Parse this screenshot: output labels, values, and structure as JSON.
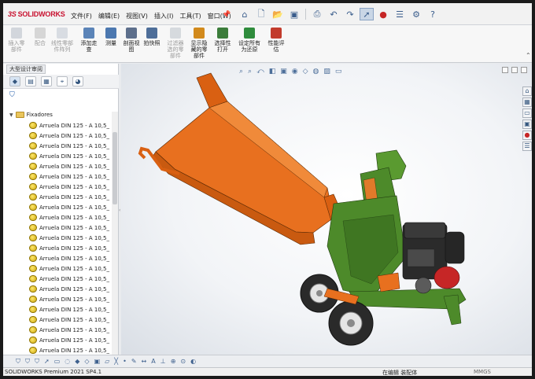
{
  "app": {
    "logo_text": "SOLIDWORKS",
    "logo_mark": "3S"
  },
  "menu": {
    "items": [
      "文件(F)",
      "编辑(E)",
      "视图(V)",
      "插入(I)",
      "工具(T)",
      "窗口(W)"
    ]
  },
  "quick_access": {
    "icons": [
      "home-icon",
      "new-icon",
      "open-icon",
      "save-icon",
      "print-icon",
      "undo-icon",
      "redo-icon",
      "select-icon",
      "rebuild-icon",
      "file-properties-icon",
      "options-icon",
      "help-icon"
    ]
  },
  "ribbon": {
    "buttons": [
      {
        "label": "插入零\n部件",
        "disabled": true,
        "color": "#9aa6b4"
      },
      {
        "label": "配合",
        "disabled": true,
        "color": "#a6a6a6"
      },
      {
        "label": "线性零部\n件阵列",
        "disabled": true,
        "color": "#a9b4c2"
      },
      {
        "label": "添加走\n查",
        "disabled": false,
        "color": "#5b84b8"
      },
      {
        "label": "测量",
        "disabled": false,
        "color": "#4c78b0"
      },
      {
        "label": "剖面视\n图",
        "disabled": false,
        "color": "#5d6f8c"
      },
      {
        "label": "拍快照",
        "disabled": false,
        "color": "#4e6e99"
      },
      {
        "label": "过滤器\n选的零\n部件",
        "disabled": true,
        "color": "#a6aeb9"
      },
      {
        "label": "显示隐\n藏的零\n部件",
        "disabled": false,
        "color": "#d28a1c"
      },
      {
        "label": "选择性\n打开",
        "disabled": false,
        "color": "#3c7d3b"
      },
      {
        "label": "设定所有\n为还原",
        "disabled": false,
        "color": "#2f8c3c"
      },
      {
        "label": "性能评\n估",
        "disabled": false,
        "color": "#c23b2c"
      }
    ]
  },
  "feature_manager": {
    "tab_label": "大型设计审阅",
    "folder_label": "Fixadores",
    "items": [
      "Arruela DIN 125 - A 10,5_",
      "Arruela DIN 125 - A 10,5_",
      "Arruela DIN 125 - A 10,5_",
      "Arruela DIN 125 - A 10,5_",
      "Arruela DIN 125 - A 10,5_",
      "Arruela DIN 125 - A 10,5_",
      "Arruela DIN 125 - A 10,5_",
      "Arruela DIN 125 - A 10,5_",
      "Arruela DIN 125 - A 10,5_",
      "Arruela DIN 125 - A 10,5_",
      "Arruela DIN 125 - A 10,5_",
      "Arruela DIN 125 - A 10,5_",
      "Arruela DIN 125 - A 10,5_",
      "Arruela DIN 125 - A 10,5_",
      "Arruela DIN 125 - A 10,5_",
      "Arruela DIN 125 - A 10,5_",
      "Arruela DIN 125 - A 10,5_",
      "Arruela DIN 125 - A 10,5_",
      "Arruela DIN 125 - A 10,5_",
      "Arruela DIN 125 - A 10,5_",
      "Arruela DIN 125 - A 10,5_",
      "Arruela DIN 125 - A 10,5_",
      "Arruela DIN 125 - A 10,5_",
      "Arruela DIN 125 - A 10,5_"
    ]
  },
  "colors": {
    "accent": "#c8102e",
    "model_orange": "#e8701f",
    "model_green": "#4d8a2a",
    "model_dark": "#2b2b2b",
    "model_red": "#c62626"
  },
  "status": {
    "version": "SOLIDWORKS Premium 2021 SP4.1",
    "mode": "在编辑 装配体",
    "units": "MMGS"
  }
}
